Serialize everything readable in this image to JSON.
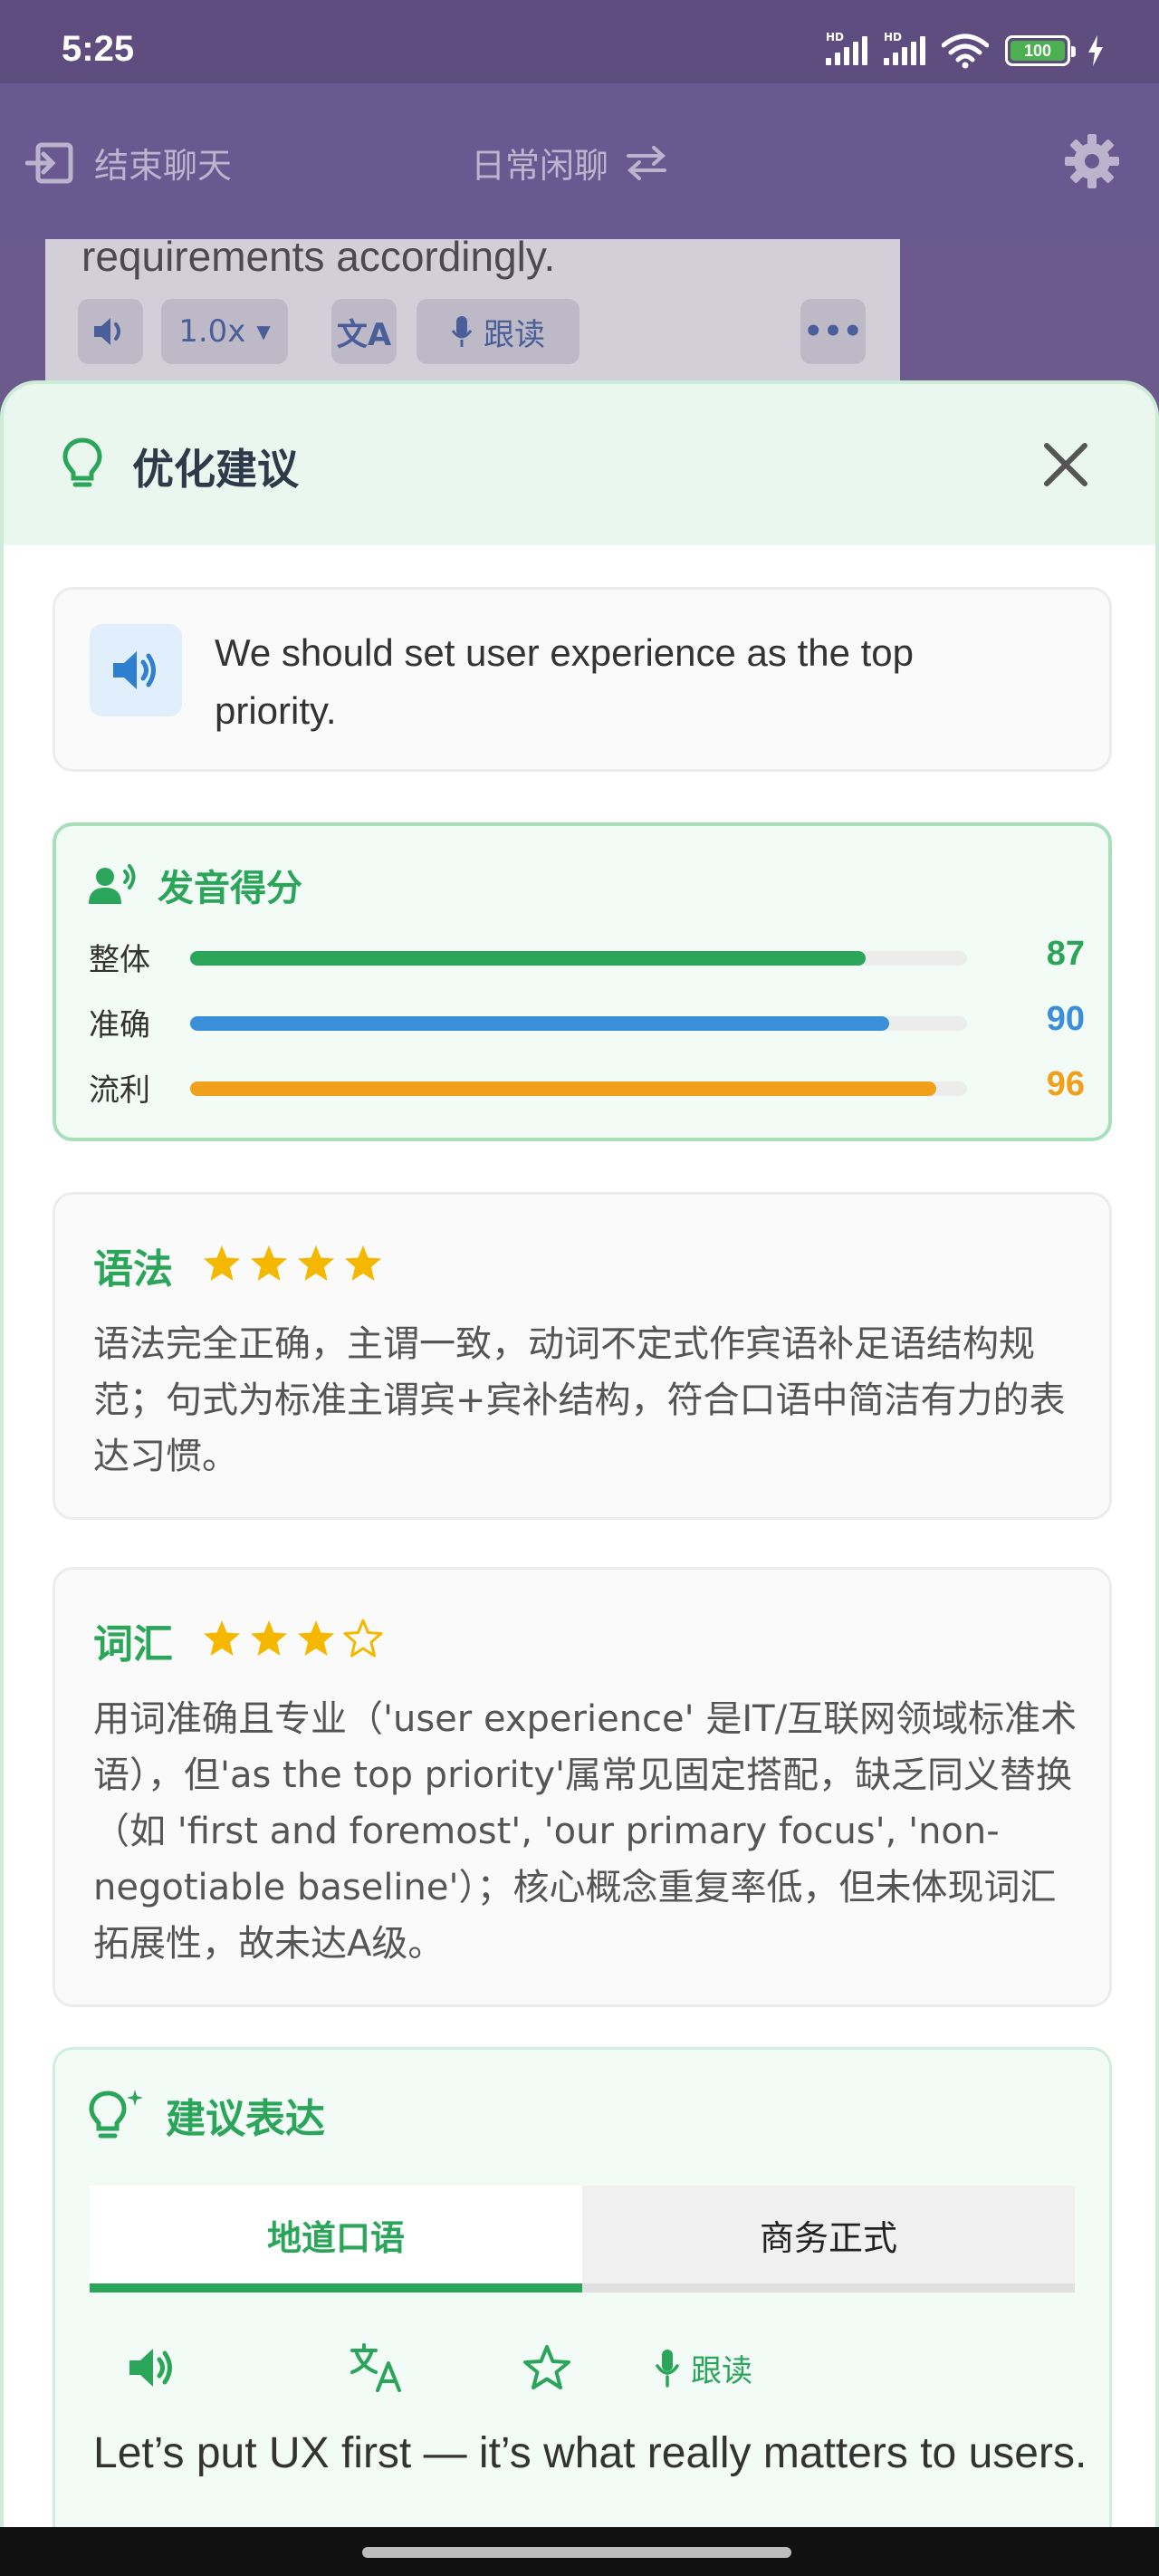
{
  "status_bar": {
    "time": "5:25",
    "battery": "100"
  },
  "app_bar": {
    "exit_label": "结束聊天",
    "mode_label": "日常闲聊"
  },
  "background_message": {
    "text": "requirements accordingly.",
    "speed": "1.0x",
    "follow_label": "跟读"
  },
  "sheet": {
    "title": "优化建议",
    "sentence": "We should set user experience as the top priority.",
    "pronunciation": {
      "title": "发音得分",
      "scores": [
        {
          "label": "整体",
          "value": 87,
          "display": "87",
          "color": "#2aa55a"
        },
        {
          "label": "准确",
          "value": 90,
          "display": "90",
          "color": "#3a8fd8"
        },
        {
          "label": "流利",
          "value": 96,
          "display": "96",
          "color": "#f0a01a"
        }
      ]
    },
    "grammar": {
      "title": "语法",
      "stars": 4,
      "max_stars": 4,
      "text": "语法完全正确，主谓一致，动词不定式作宾语补足语结构规范；句式为标准主谓宾+宾补结构，符合口语中简洁有力的表达习惯。"
    },
    "vocabulary": {
      "title": "词汇",
      "stars": 3,
      "max_stars": 4,
      "text": "用词准确且专业（'user experience' 是IT/互联网领域标准术语），但'as the top priority'属常见固定搭配，缺乏同义替换（如 'first and foremost', 'our primary focus', 'non-negotiable baseline'）；核心概念重复率低，但未体现词汇拓展性，故未达A级。"
    },
    "suggestion": {
      "title": "建议表达",
      "tabs": [
        {
          "label": "地道口语",
          "active": true
        },
        {
          "label": "商务正式",
          "active": false
        }
      ],
      "follow_label": "跟读",
      "expression": "Let’s put UX first — it’s what really matters to users."
    }
  },
  "colors": {
    "accent_green": "#2aa55a",
    "accent_blue": "#3a8fd8",
    "accent_orange": "#f0a01a",
    "star_yellow": "#f5b800"
  }
}
